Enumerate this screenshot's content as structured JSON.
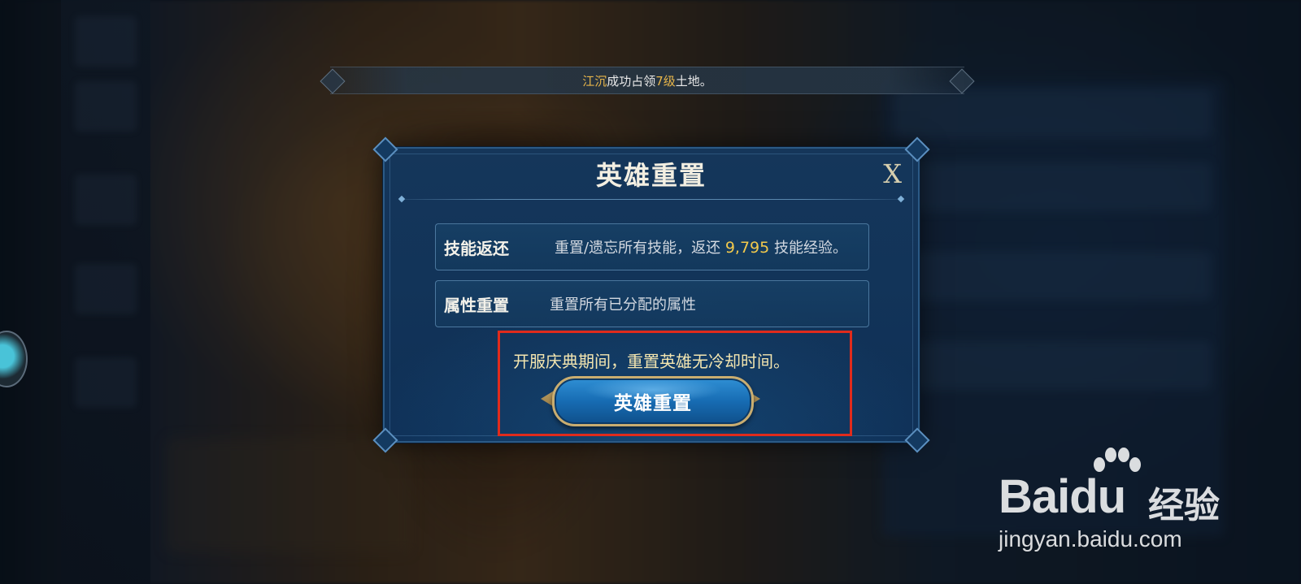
{
  "notice": {
    "player_name": "江沉",
    "text_before_level": "成功占领",
    "level": "7级",
    "text_after_level": "土地。"
  },
  "dialog": {
    "title": "英雄重置",
    "close_label": "X",
    "options": [
      {
        "label": "技能返还",
        "desc_before": "重置/遗忘所有技能，返还",
        "value": "9,795",
        "desc_after": "技能经验。"
      },
      {
        "label": "属性重置",
        "desc": "重置所有已分配的属性"
      }
    ],
    "promo_text": "开服庆典期间，重置英雄无冷却时间。",
    "reset_button_label": "英雄重置"
  },
  "watermark": {
    "logo_text": "Bai",
    "logo_du": "du",
    "logo_cn": "经验",
    "url": "jingyan.baidu.com"
  },
  "colors": {
    "gold_text": "#e8b64a",
    "value_yellow": "#f2c94c",
    "annotation_red": "#e02b1c",
    "button_blue": "#176cb3"
  }
}
